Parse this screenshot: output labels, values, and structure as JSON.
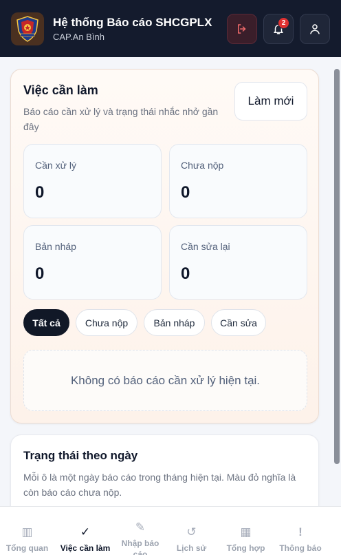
{
  "header": {
    "title": "Hệ thống Báo cáo SHCGPLX",
    "subtitle": "CAP.An Bình",
    "notification_count": "2",
    "icons": {
      "logo": "police-badge-logo",
      "logout": "logout-icon",
      "bell": "bell-icon",
      "user": "user-icon"
    },
    "colors": {
      "bg": "#141b2d",
      "badge": "#e03131"
    }
  },
  "todo": {
    "title": "Việc cần làm",
    "description": "Báo cáo cần xử lý và trạng thái nhắc nhở gần đây",
    "refresh_label": "Làm mới",
    "stats": [
      {
        "label": "Cần xử lý",
        "value": "0"
      },
      {
        "label": "Chưa nộp",
        "value": "0"
      },
      {
        "label": "Bản nháp",
        "value": "0"
      },
      {
        "label": "Cần sửa lại",
        "value": "0"
      }
    ],
    "filters": [
      {
        "label": "Tất cả",
        "active": true
      },
      {
        "label": "Chưa nộp",
        "active": false
      },
      {
        "label": "Bản nháp",
        "active": false
      },
      {
        "label": "Cần sửa",
        "active": false
      }
    ],
    "empty_message": "Không có báo cáo cần xử lý hiện tại."
  },
  "status_by_day": {
    "title": "Trạng thái theo ngày",
    "description": "Mỗi ô là một ngày báo cáo trong tháng hiện tại. Màu đỏ nghĩa là còn báo cáo chưa nộp."
  },
  "bottom_nav": [
    {
      "label": "Tổng quan",
      "icon": "dashboard-icon",
      "glyph": "▥",
      "active": false
    },
    {
      "label": "Việc cần làm",
      "icon": "checkmark-icon",
      "glyph": "✓",
      "active": true
    },
    {
      "label": "Nhập báo cáo",
      "icon": "pencil-icon",
      "glyph": "✎",
      "active": false
    },
    {
      "label": "Lịch sử",
      "icon": "history-icon",
      "glyph": "↺",
      "active": false
    },
    {
      "label": "Tổng hợp",
      "icon": "grid-icon",
      "glyph": "▦",
      "active": false
    },
    {
      "label": "Thông báo",
      "icon": "alert-icon",
      "glyph": "!",
      "active": false
    }
  ]
}
